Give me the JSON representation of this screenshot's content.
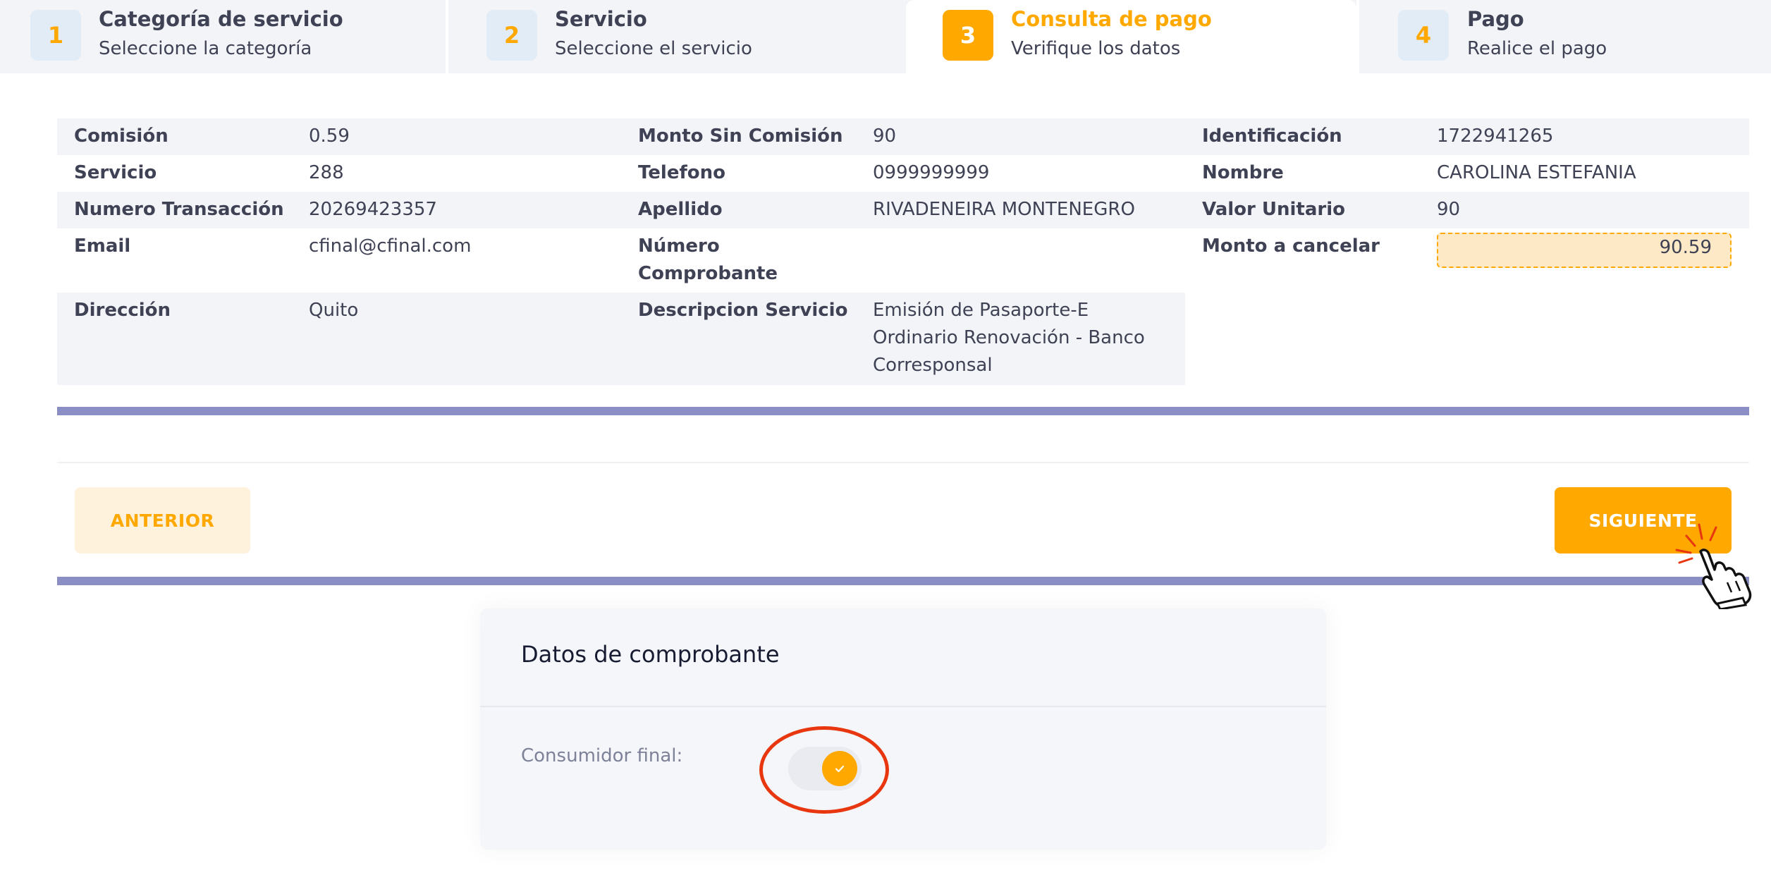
{
  "colors": {
    "accent": "#ffa800",
    "divider_bar": "#8b8ec4",
    "highlight_ring": "#e8360f"
  },
  "steps": [
    {
      "num": "1",
      "title": "Categoría de servicio",
      "subtitle": "Seleccione la categoría",
      "state": "done"
    },
    {
      "num": "2",
      "title": "Servicio",
      "subtitle": "Seleccione el servicio",
      "state": "done"
    },
    {
      "num": "3",
      "title": "Consulta de pago",
      "subtitle": "Verifique los datos",
      "state": "active"
    },
    {
      "num": "4",
      "title": "Pago",
      "subtitle": "Realice el pago",
      "state": "pending"
    }
  ],
  "details": {
    "comision": {
      "label": "Comisión",
      "value": "0.59"
    },
    "monto_sin_comision": {
      "label": "Monto Sin Comisión",
      "value": "90"
    },
    "identificacion": {
      "label": "Identificación",
      "value": "1722941265"
    },
    "servicio": {
      "label": "Servicio",
      "value": "288"
    },
    "telefono": {
      "label": "Telefono",
      "value": "0999999999"
    },
    "nombre": {
      "label": "Nombre",
      "value": "CAROLINA ESTEFANIA"
    },
    "numero_transaccion": {
      "label": "Numero Transacción",
      "value": "20269423357"
    },
    "apellido": {
      "label": "Apellido",
      "value": "RIVADENEIRA MONTENEGRO"
    },
    "valor_unitario": {
      "label": "Valor Unitario",
      "value": "90"
    },
    "email": {
      "label": "Email",
      "value": "cfinal@cfinal.com"
    },
    "numero_comprobante": {
      "label_line1": "Número",
      "label_line2": "Comprobante",
      "value": ""
    },
    "monto_a_cancelar": {
      "label": "Monto a cancelar",
      "value": "90.59"
    },
    "direccion": {
      "label": "Dirección",
      "value": "Quito"
    },
    "descripcion_servicio": {
      "label": "Descripcion Servicio",
      "value_line1": "Emisión de Pasaporte-E",
      "value_line2": "Ordinario Renovación - Banco",
      "value_line3": "Corresponsal"
    }
  },
  "buttons": {
    "prev": "ANTERIOR",
    "next": "SIGUIENTE"
  },
  "voucher": {
    "title": "Datos de comprobante",
    "consumidor_final_label": "Consumidor final:",
    "consumidor_final_checked": true
  },
  "icons": {
    "pointer": "hand-pointer-icon",
    "check": "check-icon"
  }
}
